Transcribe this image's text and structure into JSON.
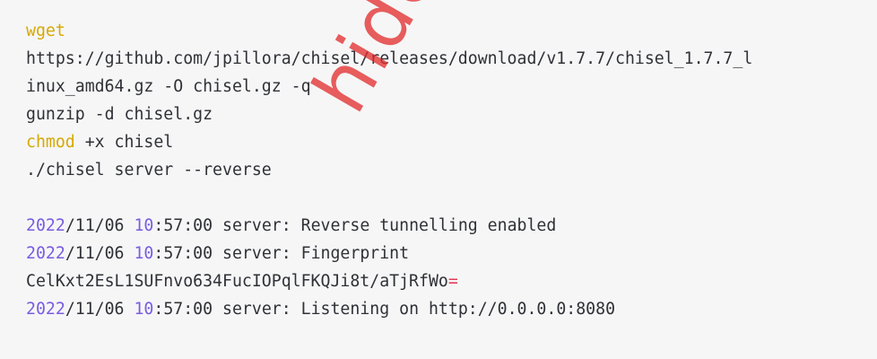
{
  "code": {
    "cmd_wget": "wget",
    "url_line1": "https://github.com/jpillora/chisel/releases/download/v1.7.7/chisel_1.7.7_l",
    "url_line2": "inux_amd64.gz -O chisel.gz -q",
    "gunzip_line": "gunzip -d chisel.gz",
    "cmd_chmod": "chmod",
    "chmod_args": " +x chisel",
    "server_line": "./chisel server --reverse",
    "log": [
      {
        "year": "2022",
        "mid": "/11/06 ",
        "hour": "10",
        "rest": ":57:00 server: Reverse tunnelling enabled"
      },
      {
        "year": "2022",
        "mid": "/11/06 ",
        "hour": "10",
        "rest": ":57:00 server: Fingerprint"
      },
      {
        "year": "2022",
        "mid": "/11/06 ",
        "hour": "10",
        "rest": ":57:00 server: Listening on http://0.0.0.0:8080"
      }
    ],
    "fingerprint_text": "CelKxt2EsL1SUFnvo634FucIOPqlFKQJi8t/aTjRfWo",
    "fingerprint_eq": "="
  },
  "colors": {
    "keyword": "#d6a800",
    "number": "#7a5de0",
    "operator": "#e0405a",
    "text": "#2f3136",
    "background": "#f6f6f7",
    "watermark": "#e12828"
  },
  "watermark": {
    "text": "hide"
  }
}
